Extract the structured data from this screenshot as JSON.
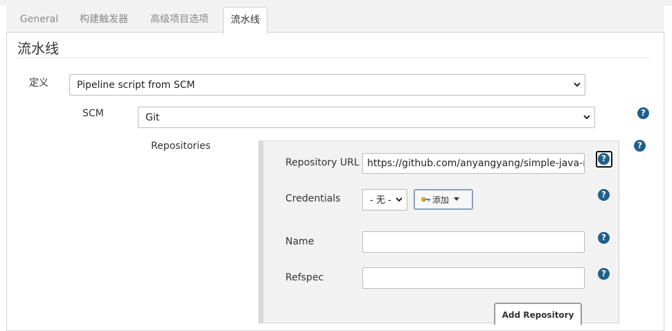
{
  "tabs": [
    {
      "label": "General"
    },
    {
      "label": "构建触发器"
    },
    {
      "label": "高级项目选项"
    },
    {
      "label": "流水线",
      "active": true
    }
  ],
  "section": {
    "title": "流水线"
  },
  "definition": {
    "label": "定义",
    "value": "Pipeline script from SCM"
  },
  "scm": {
    "label": "SCM",
    "value": "Git"
  },
  "repositories": {
    "label": "Repositories",
    "repository_url": {
      "label": "Repository URL",
      "value": "https://github.com/anyangyang/simple-java-ma"
    },
    "credentials": {
      "label": "Credentials",
      "value": "- 无 -",
      "add_label": "添加"
    },
    "name": {
      "label": "Name",
      "value": ""
    },
    "refspec": {
      "label": "Refspec",
      "value": ""
    },
    "add_repository_label": "Add Repository"
  },
  "help_glyph": "?",
  "colors": {
    "help": "#1f5f8b",
    "tab_bg": "#f2f2f2",
    "border": "#d3d3d3"
  }
}
